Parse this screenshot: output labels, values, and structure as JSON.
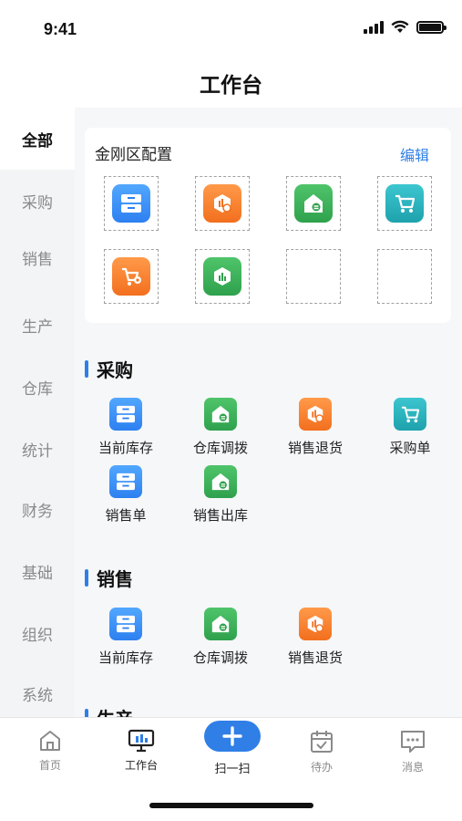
{
  "status_bar": {
    "time": "9:41"
  },
  "nav": {
    "title": "工作台"
  },
  "sidebar": {
    "items": [
      {
        "label": "全部",
        "active": true
      },
      {
        "label": "采购",
        "active": false
      },
      {
        "label": "销售",
        "active": false
      },
      {
        "label": "生产",
        "active": false
      },
      {
        "label": "仓库",
        "active": false
      },
      {
        "label": "统计",
        "active": false
      },
      {
        "label": "财务",
        "active": false
      },
      {
        "label": "基础",
        "active": false
      },
      {
        "label": "组织",
        "active": false
      },
      {
        "label": "系统",
        "active": false
      }
    ]
  },
  "config": {
    "title": "金刚区配置",
    "edit_label": "编辑",
    "slots": [
      {
        "icon": "inventory-icon",
        "color": "#2d80f0"
      },
      {
        "icon": "sales-return-icon",
        "color": "#f26f1e"
      },
      {
        "icon": "warehouse-transfer-icon",
        "color": "#2fa14d"
      },
      {
        "icon": "cart-icon",
        "color": "#1ea2ad"
      },
      {
        "icon": "cart-add-icon",
        "color": "#f26f1e"
      },
      {
        "icon": "sales-outbound-icon",
        "color": "#2fa14d"
      },
      {
        "icon": "empty-slot",
        "color": ""
      },
      {
        "icon": "empty-slot",
        "color": ""
      }
    ]
  },
  "sections": {
    "purchase": {
      "title": "采购",
      "items": [
        {
          "label": "当前库存",
          "icon": "inventory-icon"
        },
        {
          "label": "仓库调拨",
          "icon": "warehouse-transfer-icon"
        },
        {
          "label": "销售退货",
          "icon": "sales-return-icon"
        },
        {
          "label": "采购单",
          "icon": "cart-icon"
        },
        {
          "label": "销售单",
          "icon": "inventory-icon"
        },
        {
          "label": "销售出库",
          "icon": "warehouse-transfer-icon"
        }
      ]
    },
    "sales": {
      "title": "销售",
      "items": [
        {
          "label": "当前库存",
          "icon": "inventory-icon"
        },
        {
          "label": "仓库调拨",
          "icon": "warehouse-transfer-icon"
        },
        {
          "label": "销售退货",
          "icon": "sales-return-icon"
        }
      ]
    },
    "production": {
      "title": "生产"
    }
  },
  "tabbar": {
    "home": "首页",
    "workbench": "工作台",
    "scan": "扫一扫",
    "todo": "待办",
    "messages": "消息"
  },
  "colors": {
    "accent": "#2f7fe6"
  }
}
